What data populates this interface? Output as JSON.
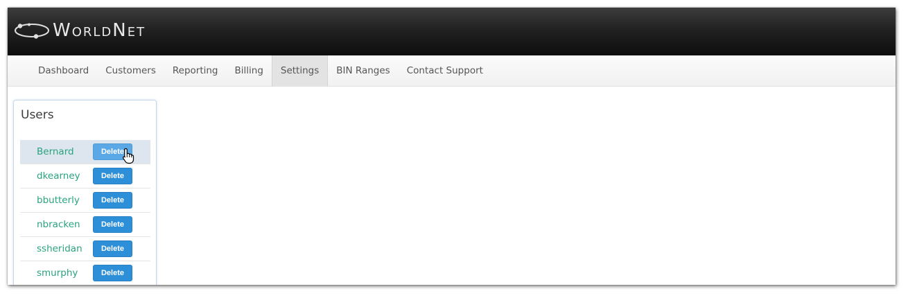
{
  "brand": {
    "name": "WorldNet",
    "logo_icon": "orbit-logo-icon"
  },
  "nav": {
    "items": [
      {
        "label": "Dashboard"
      },
      {
        "label": "Customers"
      },
      {
        "label": "Reporting"
      },
      {
        "label": "Billing"
      },
      {
        "label": "Settings",
        "active": true
      },
      {
        "label": "BIN Ranges"
      },
      {
        "label": "Contact Support"
      }
    ]
  },
  "users_panel": {
    "title": "Users",
    "delete_label": "Delete",
    "users": [
      {
        "name": "Bernard",
        "hovered": true
      },
      {
        "name": "dkearney"
      },
      {
        "name": "bbutterly"
      },
      {
        "name": "nbracken"
      },
      {
        "name": "ssheridan"
      },
      {
        "name": "smurphy"
      }
    ]
  },
  "colors": {
    "topbar": "#111111",
    "nav_active": "#e3e3e3",
    "user_link": "#29a37f",
    "button": "#2e8fd9",
    "button_hover": "#5aa9e6",
    "row_hover": "#dde6ee"
  }
}
